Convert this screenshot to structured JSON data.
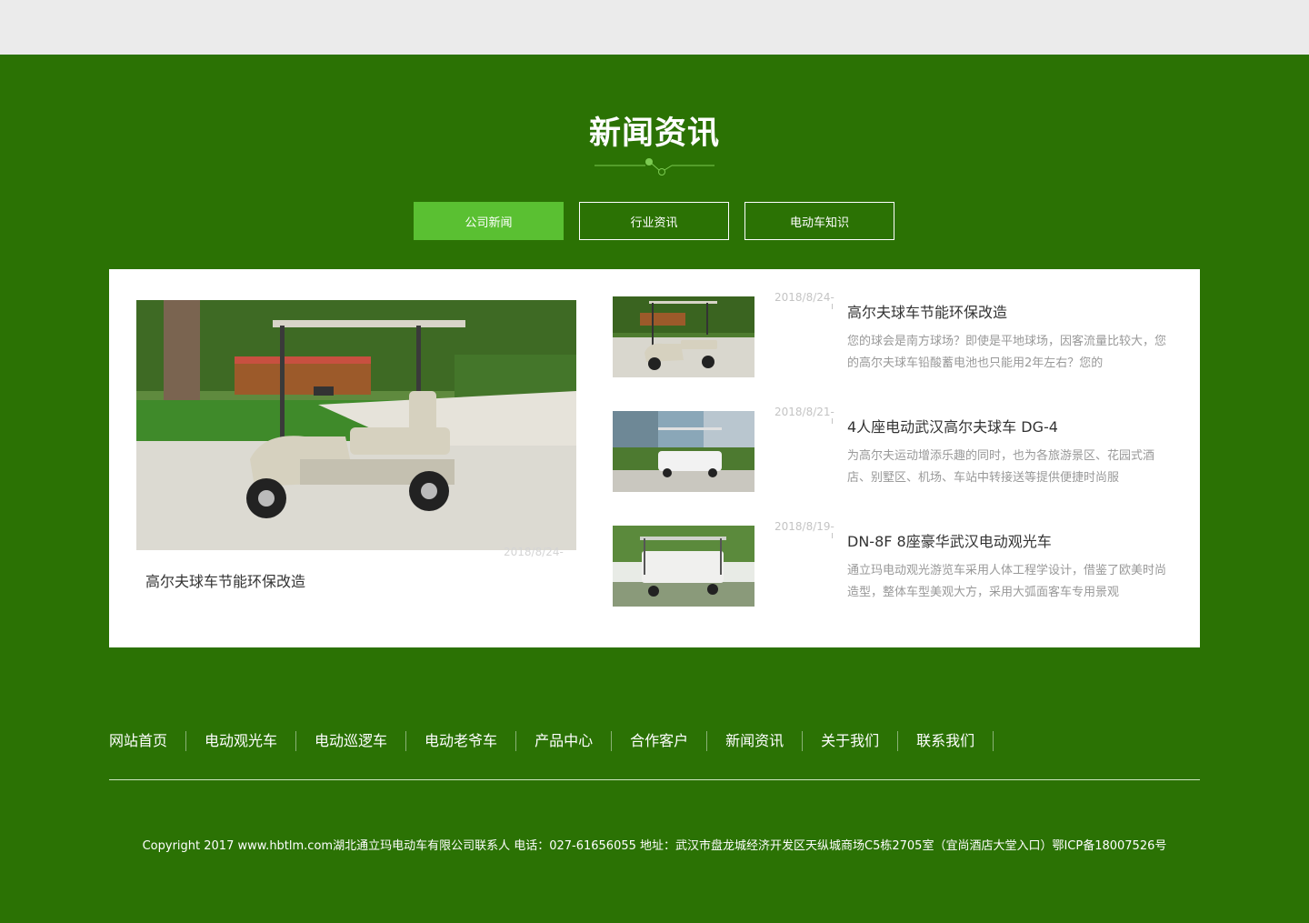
{
  "section": {
    "title": "新闻资讯"
  },
  "tabs": [
    {
      "label": "公司新闻",
      "active": true
    },
    {
      "label": "行业资讯",
      "active": false
    },
    {
      "label": "电动车知识",
      "active": false
    }
  ],
  "featured": {
    "date": "2018/8/24-",
    "title": "高尔夫球车节能环保改造"
  },
  "news": [
    {
      "date": "2018/8/24-",
      "title": "高尔夫球车节能环保改造",
      "desc": "您的球会是南方球场？即使是平地球场，因客流量比较大，您的高尔夫球车铅酸蓄电池也只能用2年左右？您的"
    },
    {
      "date": "2018/8/21-",
      "title": "4人座电动武汉高尔夫球车 DG-4",
      "desc": "为高尔夫运动增添乐趣的同时，也为各旅游景区、花园式酒店、别墅区、机场、车站中转接送等提供便捷时尚服"
    },
    {
      "date": "2018/8/19-",
      "title": "DN-8F 8座豪华武汉电动观光车",
      "desc": "通立玛电动观光游览车采用人体工程学设计，借鉴了欧美时尚造型，整体车型美观大方，采用大弧面客车专用景观"
    }
  ],
  "footer": {
    "nav": [
      "网站首页",
      "电动观光车",
      "电动巡逻车",
      "电动老爷车",
      "产品中心",
      "合作客户",
      "新闻资讯",
      "关于我们",
      "联系我们"
    ],
    "copyright": "Copyright 2017 www.hbtlm.com湖北通立玛电动车有限公司联系人 电话：027-61656055 地址：武汉市盘龙城经济开发区天纵城商场C5栋2705室（宜尚酒店大堂入口）鄂ICP备18007526号"
  },
  "colors": {
    "background": "#2b7204",
    "accent": "#5ac032",
    "panel": "#ffffff"
  }
}
